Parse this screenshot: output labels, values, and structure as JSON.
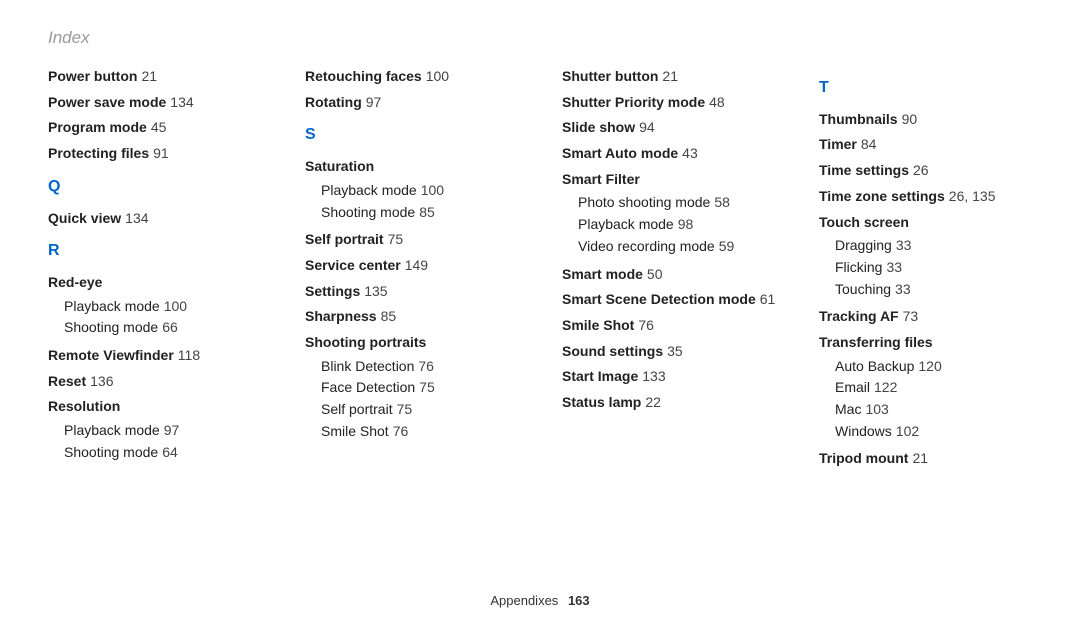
{
  "header": "Index",
  "footer": {
    "section": "Appendixes",
    "page": "163"
  },
  "columns": [
    [
      {
        "type": "entry",
        "label": "Power button",
        "pages": "21"
      },
      {
        "type": "entry",
        "label": "Power save mode",
        "pages": "134"
      },
      {
        "type": "entry",
        "label": "Program mode",
        "pages": "45"
      },
      {
        "type": "entry",
        "label": "Protecting files",
        "pages": "91"
      },
      {
        "type": "letter",
        "text": "Q"
      },
      {
        "type": "entry",
        "label": "Quick view",
        "pages": "134"
      },
      {
        "type": "letter",
        "text": "R"
      },
      {
        "type": "sub",
        "head": "Red-eye",
        "items": [
          {
            "label": "Playback mode",
            "pages": "100"
          },
          {
            "label": "Shooting mode",
            "pages": "66"
          }
        ]
      },
      {
        "type": "entry",
        "label": "Remote Viewfinder",
        "pages": "118"
      },
      {
        "type": "entry",
        "label": "Reset",
        "pages": "136"
      },
      {
        "type": "sub",
        "head": "Resolution",
        "items": [
          {
            "label": "Playback mode",
            "pages": "97"
          },
          {
            "label": "Shooting mode",
            "pages": "64"
          }
        ]
      }
    ],
    [
      {
        "type": "entry",
        "label": "Retouching faces",
        "pages": "100"
      },
      {
        "type": "entry",
        "label": "Rotating",
        "pages": "97"
      },
      {
        "type": "letter",
        "text": "S"
      },
      {
        "type": "sub",
        "head": "Saturation",
        "items": [
          {
            "label": "Playback mode",
            "pages": "100"
          },
          {
            "label": "Shooting mode",
            "pages": "85"
          }
        ]
      },
      {
        "type": "entry",
        "label": "Self portrait",
        "pages": "75"
      },
      {
        "type": "entry",
        "label": "Service center",
        "pages": "149"
      },
      {
        "type": "entry",
        "label": "Settings",
        "pages": "135"
      },
      {
        "type": "entry",
        "label": "Sharpness",
        "pages": "85"
      },
      {
        "type": "sub",
        "head": "Shooting portraits",
        "items": [
          {
            "label": "Blink Detection",
            "pages": "76"
          },
          {
            "label": "Face Detection",
            "pages": "75"
          },
          {
            "label": "Self portrait",
            "pages": "75"
          },
          {
            "label": "Smile Shot",
            "pages": "76"
          }
        ]
      }
    ],
    [
      {
        "type": "entry",
        "label": "Shutter button",
        "pages": "21"
      },
      {
        "type": "entry",
        "label": "Shutter Priority mode",
        "pages": "48"
      },
      {
        "type": "entry",
        "label": "Slide show",
        "pages": "94"
      },
      {
        "type": "entry",
        "label": "Smart Auto mode",
        "pages": "43"
      },
      {
        "type": "sub",
        "head": "Smart Filter",
        "items": [
          {
            "label": "Photo shooting mode",
            "pages": "58"
          },
          {
            "label": "Playback mode",
            "pages": "98"
          },
          {
            "label": "Video recording mode",
            "pages": "59"
          }
        ]
      },
      {
        "type": "entry",
        "label": "Smart mode",
        "pages": "50"
      },
      {
        "type": "entry",
        "label": "Smart Scene Detection mode",
        "pages": "61"
      },
      {
        "type": "entry",
        "label": "Smile Shot",
        "pages": "76"
      },
      {
        "type": "entry",
        "label": "Sound settings",
        "pages": "35"
      },
      {
        "type": "entry",
        "label": "Start Image",
        "pages": "133"
      },
      {
        "type": "entry",
        "label": "Status lamp",
        "pages": "22"
      }
    ],
    [
      {
        "type": "letter",
        "text": "T"
      },
      {
        "type": "entry",
        "label": "Thumbnails",
        "pages": "90"
      },
      {
        "type": "entry",
        "label": "Timer",
        "pages": "84"
      },
      {
        "type": "entry",
        "label": "Time settings",
        "pages": "26"
      },
      {
        "type": "entry",
        "label": "Time zone settings",
        "pages": "26, 135"
      },
      {
        "type": "sub",
        "head": "Touch screen",
        "items": [
          {
            "label": "Dragging",
            "pages": "33"
          },
          {
            "label": "Flicking",
            "pages": "33"
          },
          {
            "label": "Touching",
            "pages": "33"
          }
        ]
      },
      {
        "type": "entry",
        "label": "Tracking AF",
        "pages": "73"
      },
      {
        "type": "sub",
        "head": "Transferring files",
        "items": [
          {
            "label": "Auto Backup",
            "pages": "120"
          },
          {
            "label": "Email",
            "pages": "122"
          },
          {
            "label": "Mac",
            "pages": "103"
          },
          {
            "label": "Windows",
            "pages": "102"
          }
        ]
      },
      {
        "type": "entry",
        "label": "Tripod mount",
        "pages": "21"
      }
    ]
  ]
}
